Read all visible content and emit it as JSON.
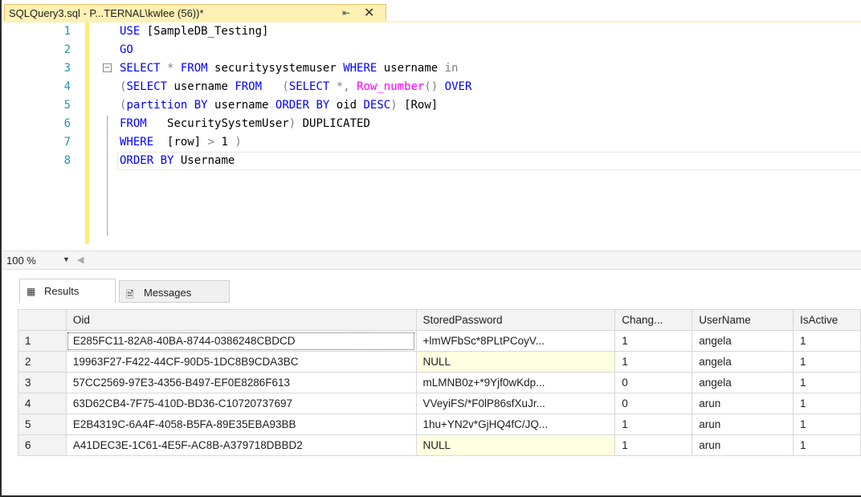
{
  "tab": {
    "title": "SQLQuery3.sql - P...TERNAL\\kwlee (56))*",
    "pin_icon": "pin-icon",
    "close_icon": "close-icon"
  },
  "editor": {
    "lines": [
      {
        "num": "1",
        "tokens": [
          {
            "t": "USE ",
            "c": "kw"
          },
          {
            "t": "[SampleDB_Testing]",
            "c": "str"
          }
        ]
      },
      {
        "num": "2",
        "tokens": [
          {
            "t": "GO",
            "c": "kw"
          }
        ]
      },
      {
        "num": "3",
        "tokens": [
          {
            "t": "SELECT ",
            "c": "kw"
          },
          {
            "t": "* ",
            "c": "op"
          },
          {
            "t": "FROM ",
            "c": "kw"
          },
          {
            "t": "securitysystemuser ",
            "c": "str"
          },
          {
            "t": "WHERE ",
            "c": "kw"
          },
          {
            "t": "username ",
            "c": "str"
          },
          {
            "t": "in",
            "c": "op"
          }
        ]
      },
      {
        "num": "4",
        "tokens": [
          {
            "t": "(",
            "c": "op"
          },
          {
            "t": "SELECT ",
            "c": "kw"
          },
          {
            "t": "username ",
            "c": "str"
          },
          {
            "t": "FROM   ",
            "c": "kw"
          },
          {
            "t": "(",
            "c": "op"
          },
          {
            "t": "SELECT ",
            "c": "kw"
          },
          {
            "t": "*, ",
            "c": "op"
          },
          {
            "t": "Row_number",
            "c": "fn"
          },
          {
            "t": "() ",
            "c": "op"
          },
          {
            "t": "OVER",
            "c": "kw"
          }
        ]
      },
      {
        "num": "5",
        "tokens": [
          {
            "t": "(",
            "c": "op"
          },
          {
            "t": "partition ",
            "c": "kw"
          },
          {
            "t": "BY ",
            "c": "kw"
          },
          {
            "t": "username ",
            "c": "str"
          },
          {
            "t": "ORDER ",
            "c": "kw"
          },
          {
            "t": "BY ",
            "c": "kw"
          },
          {
            "t": "oid ",
            "c": "str"
          },
          {
            "t": "DESC",
            "c": "kw"
          },
          {
            "t": ") ",
            "c": "op"
          },
          {
            "t": "[Row]",
            "c": "str"
          }
        ]
      },
      {
        "num": "6",
        "tokens": [
          {
            "t": "FROM   ",
            "c": "kw"
          },
          {
            "t": "SecuritySystemUser",
            "c": "str"
          },
          {
            "t": ") ",
            "c": "op"
          },
          {
            "t": "DUPLICATED",
            "c": "str"
          }
        ]
      },
      {
        "num": "7",
        "tokens": [
          {
            "t": "WHERE  ",
            "c": "kw"
          },
          {
            "t": "[row] ",
            "c": "str"
          },
          {
            "t": "> ",
            "c": "op"
          },
          {
            "t": "1 ",
            "c": "str"
          },
          {
            "t": ")",
            "c": "op"
          }
        ]
      },
      {
        "num": "8",
        "tokens": [
          {
            "t": "ORDER ",
            "c": "kw"
          },
          {
            "t": "BY ",
            "c": "kw"
          },
          {
            "t": "Username",
            "c": "str"
          }
        ]
      }
    ],
    "fold_icon": "collapse-icon"
  },
  "zoom": {
    "value": "100 %",
    "arrow": "chevron-down-icon"
  },
  "result_tabs": [
    {
      "label": "Results",
      "icon": "grid-icon"
    },
    {
      "label": "Messages",
      "icon": "messages-icon"
    }
  ],
  "grid": {
    "columns": [
      "Oid",
      "StoredPassword",
      "Chang...",
      "UserName",
      "IsActive"
    ],
    "rows": [
      {
        "n": "1",
        "oid": "E285FC11-82A8-40BA-8744-0386248CBDCD",
        "pw": "+lmWFbSc*8PLtPCoyV...",
        "chg": "1",
        "user": "angela",
        "active": "1"
      },
      {
        "n": "2",
        "oid": "19963F27-F422-44CF-90D5-1DC8B9CDA3BC",
        "pw": "NULL",
        "chg": "1",
        "user": "angela",
        "active": "1"
      },
      {
        "n": "3",
        "oid": "57CC2569-97E3-4356-B497-EF0E8286F613",
        "pw": "mLMNB0z+*9Yjf0wKdp...",
        "chg": "0",
        "user": "angela",
        "active": "1"
      },
      {
        "n": "4",
        "oid": "63D62CB4-7F75-410D-BD36-C10720737697",
        "pw": "VVeyiFS/*F0lP86sfXuJr...",
        "chg": "0",
        "user": "arun",
        "active": "1"
      },
      {
        "n": "5",
        "oid": "E2B4319C-6A4F-4058-B5FA-89E35EBA93BB",
        "pw": "1hu+YN2v*GjHQ4fC/JQ...",
        "chg": "1",
        "user": "arun",
        "active": "1"
      },
      {
        "n": "6",
        "oid": "A41DEC3E-1C61-4E5F-AC8B-A379718DBBD2",
        "pw": "NULL",
        "chg": "1",
        "user": "arun",
        "active": "1"
      }
    ]
  },
  "colors": {
    "keyword": "#0000ff",
    "function": "#ff00ff",
    "operator": "#808080",
    "line_number": "#2b91af",
    "null_cell": "#ffffe1",
    "tab_active": "#fff0b3"
  }
}
